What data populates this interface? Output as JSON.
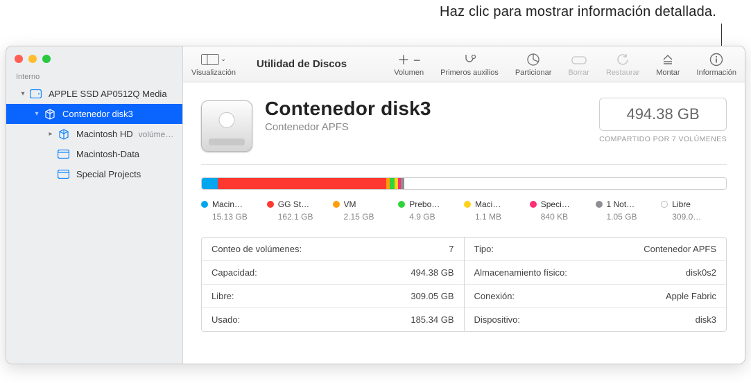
{
  "callout": "Haz clic para mostrar información detallada.",
  "toolbar": {
    "view": "Visualización",
    "title": "Utilidad de Discos",
    "volume": "Volumen",
    "firstaid": "Primeros auxilios",
    "partition": "Particionar",
    "erase": "Borrar",
    "restore": "Restaurar",
    "mount": "Montar",
    "info": "Información"
  },
  "sidebar": {
    "group": "Interno",
    "items": [
      {
        "label": "APPLE SSD AP0512Q Media",
        "indent": 0,
        "chev": "down",
        "icon": "hdd",
        "selected": false
      },
      {
        "label": "Contenedor disk3",
        "indent": 1,
        "chev": "down",
        "icon": "cube",
        "selected": true
      },
      {
        "label": "Macintosh HD",
        "suffix": "volúme…",
        "indent": 2,
        "chev": "right",
        "icon": "cube",
        "selected": false
      },
      {
        "label": "Macintosh-Data",
        "indent": 2,
        "chev": "",
        "icon": "vol",
        "selected": false
      },
      {
        "label": "Special Projects",
        "indent": 2,
        "chev": "",
        "icon": "vol",
        "selected": false
      }
    ]
  },
  "header": {
    "title": "Contenedor disk3",
    "subtitle": "Contenedor APFS",
    "capacity": "494.38 GB",
    "shared": "COMPARTIDO POR 7 VOLÚMENES"
  },
  "chart_data": {
    "type": "bar",
    "title": "Uso de almacenamiento",
    "unit": "GB",
    "total_gb": 494.38,
    "series": [
      {
        "name": "Macin…",
        "size_label": "15.13 GB",
        "gb": 15.13,
        "color": "#00a7ef"
      },
      {
        "name": "GG St…",
        "size_label": "162.1 GB",
        "gb": 162.1,
        "color": "#ff3830"
      },
      {
        "name": "VM",
        "size_label": "2.15 GB",
        "gb": 2.15,
        "color": "#ff9e0a"
      },
      {
        "name": "Prebo…",
        "size_label": "4.9 GB",
        "gb": 4.9,
        "color": "#30d33b"
      },
      {
        "name": "Maci…",
        "size_label": "1.1 MB",
        "gb": 0.0011,
        "color": "#ffd11a"
      },
      {
        "name": "Speci…",
        "size_label": "840 KB",
        "gb": 0.00084,
        "color": "#ff2d73"
      },
      {
        "name": "1 Not…",
        "size_label": "1.05 GB",
        "gb": 1.05,
        "color": "#8e8e93"
      },
      {
        "name": "Libre",
        "size_label": "309.0…",
        "gb": 309.05,
        "color": "#ffffff",
        "hollow": true
      }
    ]
  },
  "details": {
    "left": [
      {
        "k": "Conteo de volúmenes:",
        "v": "7"
      },
      {
        "k": "Capacidad:",
        "v": "494.38 GB"
      },
      {
        "k": "Libre:",
        "v": "309.05 GB"
      },
      {
        "k": "Usado:",
        "v": "185.34 GB"
      }
    ],
    "right": [
      {
        "k": "Tipo:",
        "v": "Contenedor APFS"
      },
      {
        "k": "Almacenamiento físico:",
        "v": "disk0s2"
      },
      {
        "k": "Conexión:",
        "v": "Apple Fabric"
      },
      {
        "k": "Dispositivo:",
        "v": "disk3"
      }
    ]
  }
}
